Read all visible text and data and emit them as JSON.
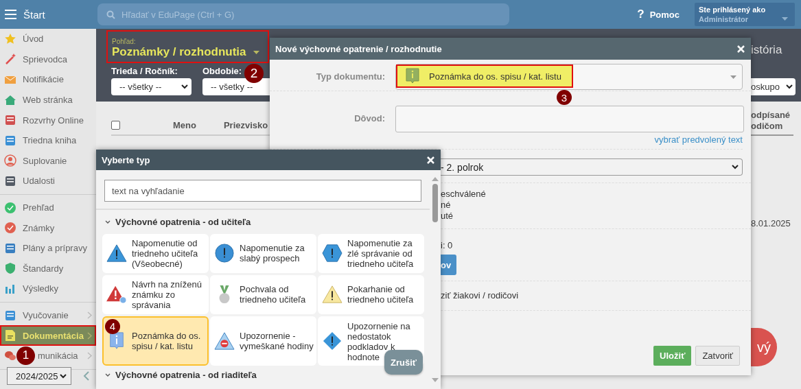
{
  "top_bar": {
    "title": "Štart",
    "search": {
      "placeholder": "Hľadať v EduPage (Ctrl + G)"
    },
    "help": {
      "icon_text": "?",
      "label": "Pomoc"
    },
    "user": {
      "label": "Ste prihlásený ako",
      "name": "Administrátor"
    }
  },
  "sidebar": {
    "sections": [
      {
        "items": [
          {
            "label": "Úvod",
            "selected": false,
            "submenu": false
          },
          {
            "label": "Sprievodca",
            "selected": false,
            "submenu": false
          },
          {
            "label": "Notifikácie",
            "selected": false,
            "submenu": false
          },
          {
            "label": "Web stránka",
            "selected": false,
            "submenu": false
          },
          {
            "label": "Rozvrhy Online",
            "selected": false,
            "submenu": false
          },
          {
            "label": "Triedna kniha",
            "selected": false,
            "submenu": false
          },
          {
            "label": "Suplovanie",
            "selected": false,
            "submenu": false
          },
          {
            "label": "Udalosti",
            "selected": false,
            "submenu": false
          }
        ]
      },
      {
        "items": [
          {
            "label": "Prehľad",
            "selected": false,
            "submenu": false
          },
          {
            "label": "Známky",
            "selected": false,
            "submenu": false
          },
          {
            "label": "Plány a prípravy",
            "selected": false,
            "submenu": false
          },
          {
            "label": "Štandardy",
            "selected": false,
            "submenu": false
          },
          {
            "label": "Výsledky",
            "selected": false,
            "submenu": false
          }
        ]
      },
      {
        "items": [
          {
            "label": "Vyučovanie",
            "selected": false,
            "submenu": true
          },
          {
            "label": "Dokumentácia",
            "selected": true,
            "submenu": true,
            "outlined": true,
            "marker": "1"
          },
          {
            "label": "munikácia",
            "selected": false,
            "submenu": true
          }
        ]
      }
    ],
    "year_select": "2024/2025"
  },
  "view": {
    "label": "Pohľad:",
    "value": "Poznámky / rozhodnutia",
    "outlined": true,
    "marker": "2"
  },
  "filters": [
    {
      "label": "Trieda / Ročník:",
      "value": "-- všetky --"
    },
    {
      "label": "Obdobie:",
      "value": "-- všetky --"
    }
  ],
  "right_strip": {
    "heading": "istória",
    "select": "oskupo",
    "column_heading": "odpísané odičom",
    "date": "8.01.2025",
    "new_button": "vý"
  },
  "table": {
    "select_all": {
      "checked": false
    },
    "columns": [
      "Meno",
      "Priezvisko"
    ]
  },
  "dialog": {
    "title": "Nové výchovné opatrenie / rozhodnutie",
    "type_label": "Typ dokumentu:",
    "type_value": "Poznámka do os. spisu / kat. listu",
    "type_outlined": true,
    "type_marker": "3",
    "reason_label": "Dôvod:",
    "preset_link": "vybrať predvolený text",
    "period": "- 2. polrok",
    "states": [
      "eschválené",
      "né",
      "uté"
    ],
    "count": "i: 0",
    "blue_button": "ov",
    "notify": "ziť žiakovi / rodičovi",
    "save": "Uložiť",
    "close": "Zatvoriť"
  },
  "type_picker": {
    "title": "Vyberte typ",
    "search": {
      "placeholder": "text na vyhľadanie"
    },
    "section": "Výchovné opatrenia - od učiteľa",
    "types": [
      {
        "label": "Napomenutie od triedneho učiteľa (Všeobecné)",
        "kind": "triangle",
        "selected": false
      },
      {
        "label": "Napomenutie za slabý prospech",
        "kind": "circle",
        "selected": false
      },
      {
        "label": "Napomenutie za zlé správanie od triedneho učiteľa",
        "kind": "hexagon",
        "selected": false
      },
      {
        "label": "Návrh na zníženú známku zo správania",
        "kind": "alert",
        "selected": false
      },
      {
        "label": "Pochvala od triedneho učiteľa",
        "kind": "medal",
        "selected": false
      },
      {
        "label": "Pokarhanie od triedneho učiteľa",
        "kind": "warning",
        "selected": false
      },
      {
        "label": "Poznámka do os. spisu / kat. listu",
        "kind": "note",
        "selected": true,
        "marker": "4"
      },
      {
        "label": "Upozornenie - vymeškané hodiny",
        "kind": "stop",
        "selected": false
      },
      {
        "label": "Upozornenie na nedostatok podkladov k hodnote",
        "kind": "diamond",
        "selected": false
      }
    ],
    "next_section": "Výchovné opatrenia - od riaditeľa",
    "cancel": "Zrušiť"
  }
}
